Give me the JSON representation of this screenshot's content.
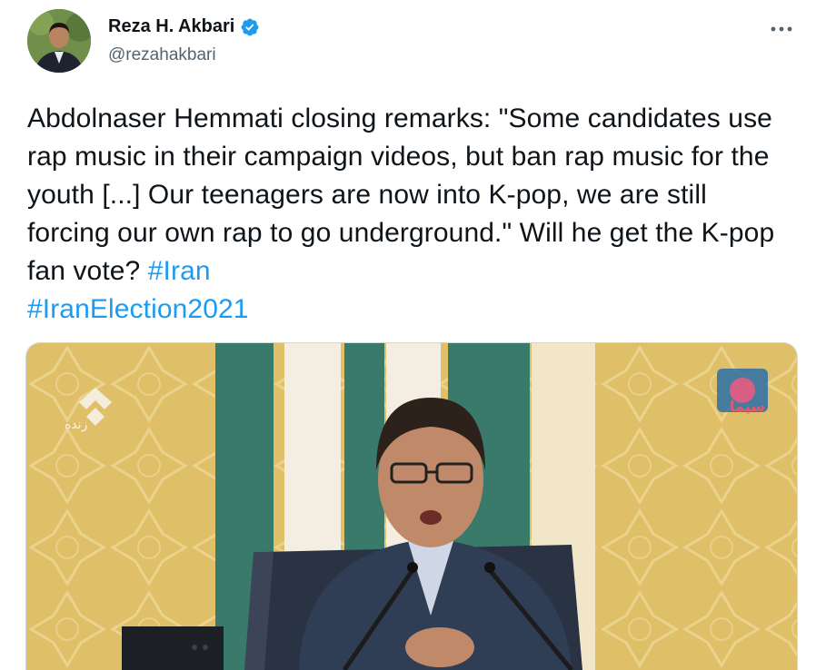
{
  "author": {
    "display_name": "Reza H. Akbari",
    "handle": "@rezahakbari",
    "verified": true
  },
  "tweet": {
    "text": "Abdolnaser Hemmati closing remarks: \"Some candidates use rap music in their campaign videos, but ban rap music for the youth [...] Our teenagers are now into K-pop, we are still forcing our own rap to go underground.\" Will he get the K-pop fan vote? ",
    "hashtags": [
      "#Iran",
      "#IranElection2021"
    ]
  },
  "media": {
    "overlay_live_label": "زنده",
    "channel_logo_text": "سیما"
  },
  "colors": {
    "hashtag": "#1d9bf0",
    "verified": "#1d9bf0",
    "handle": "#536471",
    "backdrop_gold": "#e2c36a",
    "pillar_green": "#3d7d6e"
  },
  "icons": {
    "verified": "verified-badge-icon",
    "more": "more-options-icon"
  }
}
